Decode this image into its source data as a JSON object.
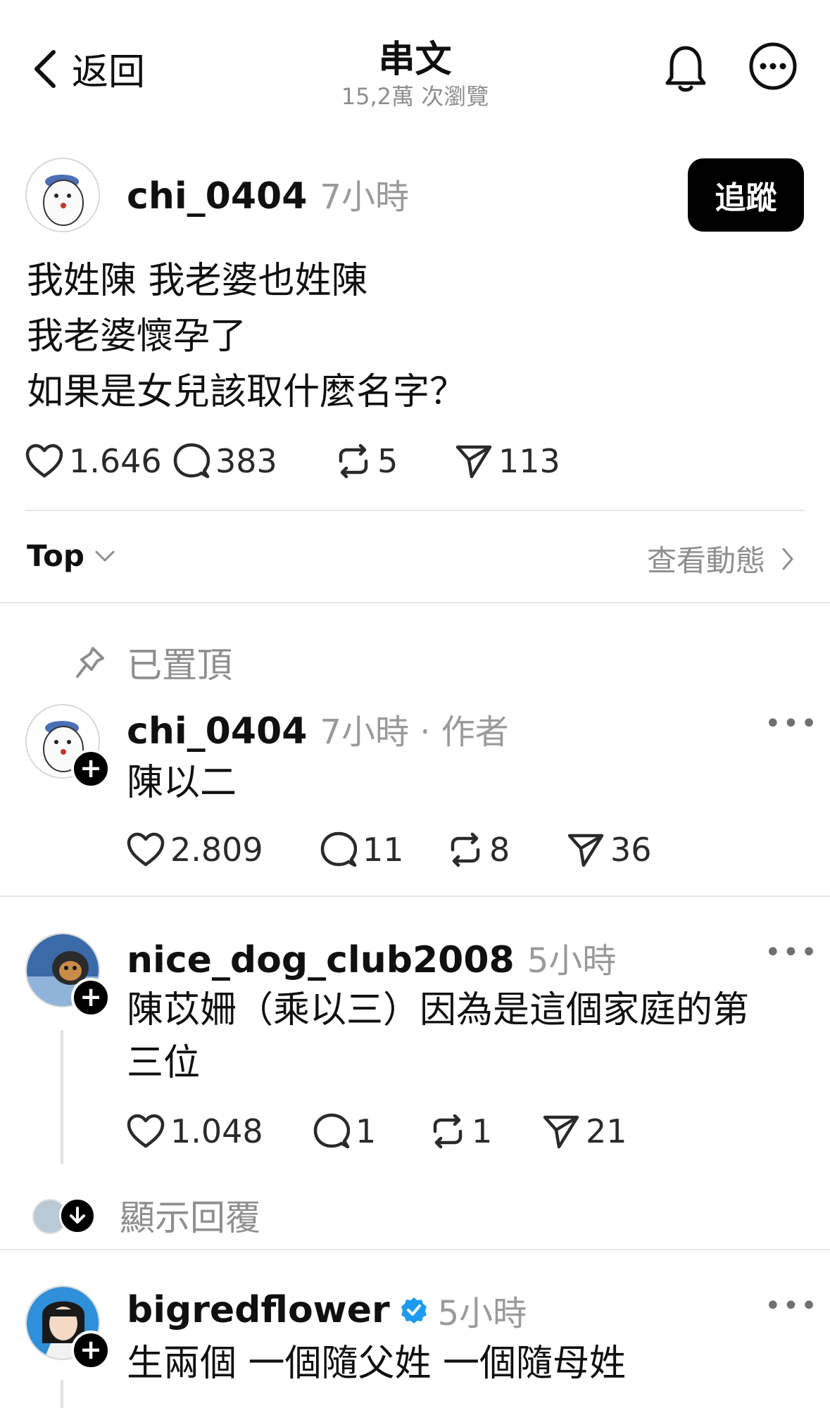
{
  "header": {
    "back_label": "返回",
    "title": "串文",
    "views": "15,2萬 次瀏覽"
  },
  "post": {
    "username": "chi_0404",
    "time": "7小時",
    "follow_label": "追蹤",
    "lines": [
      "我姓陳 我老婆也姓陳",
      "我老婆懷孕了",
      "如果是女兒該取什麼名字？"
    ],
    "likes": "1.646",
    "comments": "383",
    "reposts": "5",
    "shares": "113"
  },
  "sort": {
    "label": "Top",
    "activity_label": "查看動態"
  },
  "pinned_label": "已置頂",
  "replies": [
    {
      "username": "chi_0404",
      "meta": "7小時 · 作者",
      "text": "陳以二",
      "likes": "2.809",
      "comments": "11",
      "reposts": "8",
      "shares": "36"
    },
    {
      "username": "nice_dog_club2008",
      "meta": "5小時",
      "text_line1": "陳苡姍（乘以三）因為是這個家庭的第",
      "text_line2": "三位",
      "likes": "1.048",
      "comments": "1",
      "reposts": "1",
      "shares": "21",
      "show_replies": "顯示回覆"
    },
    {
      "username": "bigredflower",
      "meta": "5小時",
      "text": "生兩個 一個隨父姓 一個隨母姓",
      "verified": true
    }
  ],
  "colors": {
    "verified": "#1d9bf0",
    "muted": "#8e8e8e",
    "follow_bg": "#000000"
  },
  "icons": [
    "chevron-left-icon",
    "bell-icon",
    "more-circle-icon",
    "heart-icon",
    "comment-icon",
    "repost-icon",
    "share-icon",
    "pin-icon",
    "chevron-down-icon",
    "chevron-right-icon",
    "verified-icon",
    "arrow-down-icon"
  ]
}
